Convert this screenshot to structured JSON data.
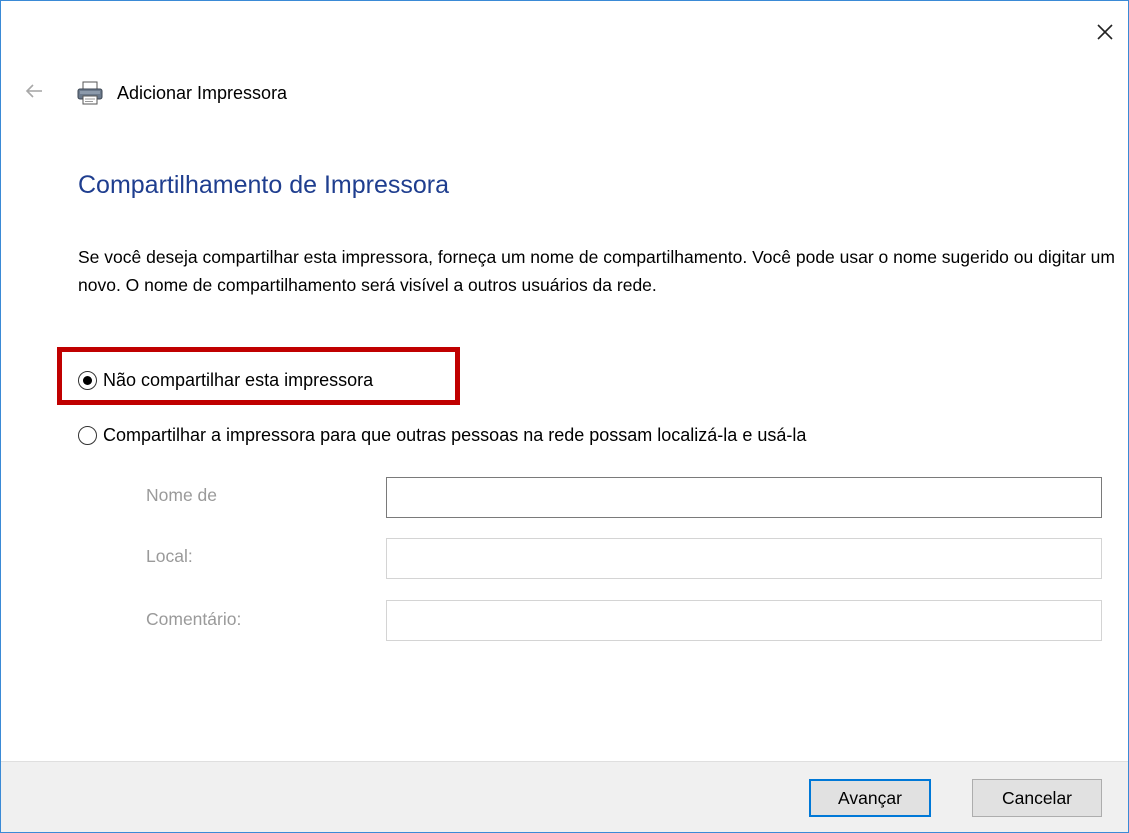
{
  "window": {
    "title": "Adicionar Impressora",
    "accent_color": "#3a8ad6"
  },
  "header": {
    "back_icon": "back-arrow-icon",
    "printer_icon": "printer-icon",
    "close_icon": "close-icon"
  },
  "main": {
    "page_title": "Compartilhamento de Impressora",
    "page_title_color": "#1f3e8f",
    "description": "Se você deseja compartilhar esta impressora, forneça um nome de compartilhamento. Você pode usar o nome sugerido ou digitar um novo. O nome de compartilhamento será visível a outros usuários da rede.",
    "options": [
      {
        "label": "Não compartilhar esta impressora",
        "checked": true
      },
      {
        "label": "Compartilhar a impressora para que outras pessoas na rede possam localizá-la e usá-la",
        "checked": false
      }
    ],
    "highlight_color": "#c00000",
    "fields": [
      {
        "label": "Nome de",
        "value": "",
        "disabled": true
      },
      {
        "label": "Local:",
        "value": "",
        "disabled": true
      },
      {
        "label": "Comentário:",
        "value": "",
        "disabled": true
      }
    ]
  },
  "footer": {
    "next_label": "Avançar",
    "cancel_label": "Cancelar"
  }
}
